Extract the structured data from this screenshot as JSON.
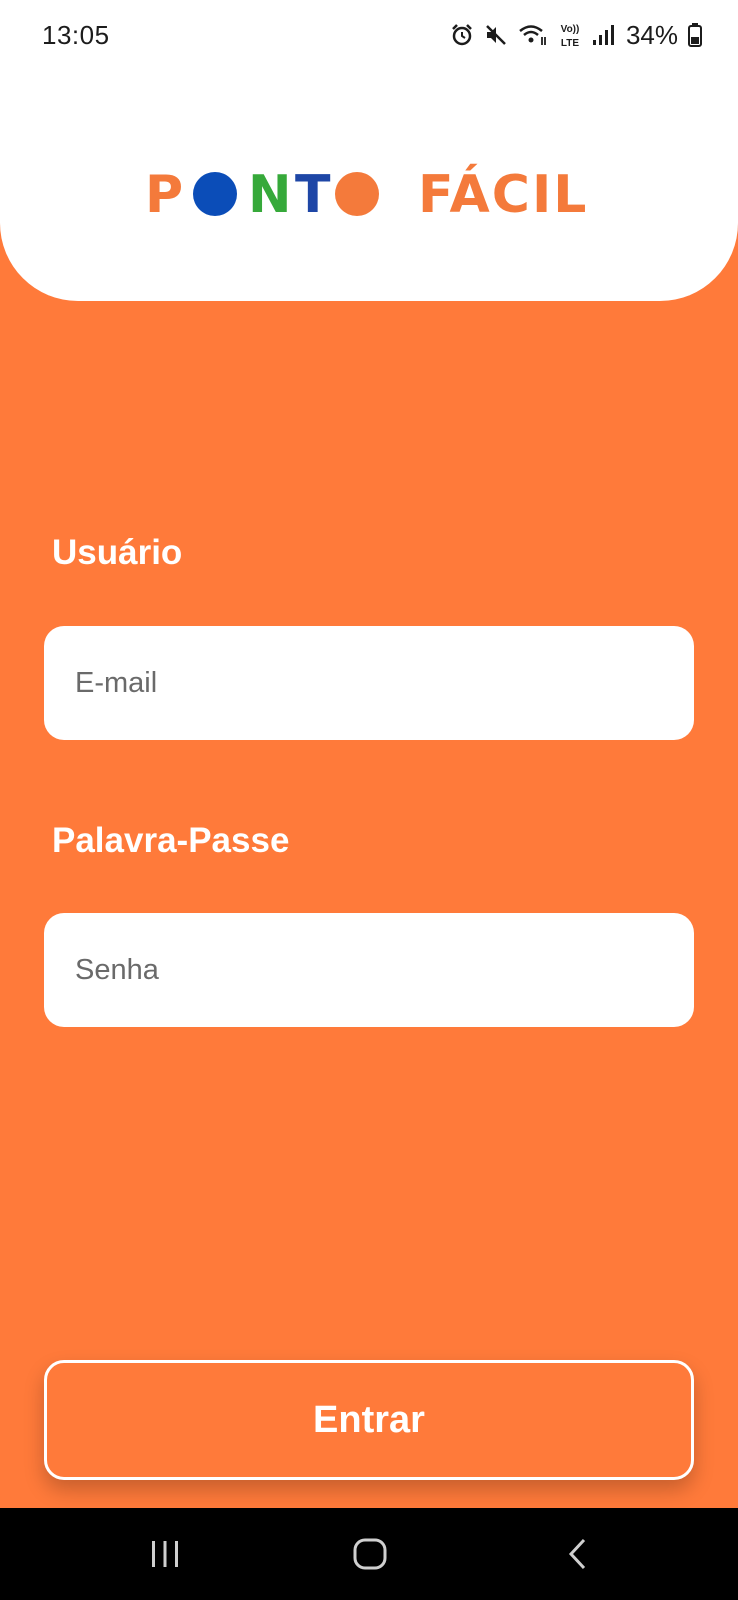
{
  "status_bar": {
    "time": "13:05",
    "battery": "34%",
    "icons": [
      "alarm-icon",
      "mute-icon",
      "wifi-icon",
      "volte-icon",
      "signal-icon",
      "battery-icon"
    ]
  },
  "header": {
    "logo": {
      "word1": "PONTO",
      "word2": "FÁCIL",
      "colors": {
        "p": "#F47A3B",
        "o1": "#0B4DB8",
        "n": "#36A93A",
        "t": "#1E46A6",
        "o2": "#F47A3B",
        "facil": "#F47A3B"
      }
    }
  },
  "form": {
    "user_label": "Usuário",
    "email_value": "",
    "email_placeholder": "E-mail",
    "password_label": "Palavra-Passe",
    "password_value": "",
    "password_placeholder": "Senha"
  },
  "actions": {
    "enter_label": "Entrar"
  },
  "theme": {
    "background": "#FF7A3A",
    "header_background": "#FFFFFF",
    "text_on_background": "#FFFFFF"
  },
  "nav_bar": {
    "buttons": [
      "recent-apps-icon",
      "home-icon",
      "back-icon"
    ]
  }
}
